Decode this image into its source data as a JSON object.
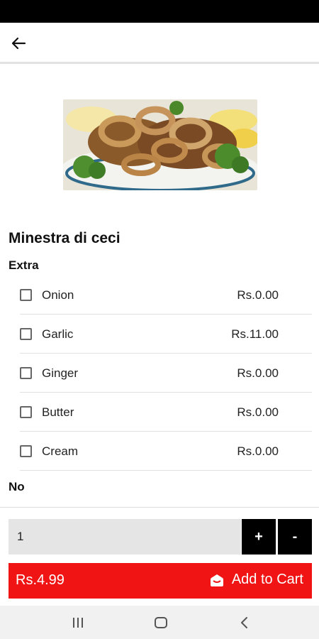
{
  "header": {
    "back_icon": "arrow-left-icon"
  },
  "product": {
    "image_alt": "fried calamari",
    "title": "Minestra di ceci"
  },
  "extras": {
    "heading": "Extra",
    "items": [
      {
        "label": "Onion",
        "price": "Rs.0.00"
      },
      {
        "label": "Garlic",
        "price": "Rs.11.00"
      },
      {
        "label": "Ginger",
        "price": "Rs.0.00"
      },
      {
        "label": "Butter",
        "price": "Rs.0.00"
      },
      {
        "label": "Cream",
        "price": "Rs.0.00"
      }
    ]
  },
  "no_section": {
    "heading": "No"
  },
  "quantity": {
    "value": "1",
    "plus_label": "+",
    "minus_label": "-"
  },
  "cart": {
    "price": "Rs.4.99",
    "button_label": "Add to Cart",
    "icon": "cart-icon"
  },
  "colors": {
    "accent": "#f01414",
    "qty_button": "#000000",
    "qty_field": "#e5e5e5"
  },
  "nav": {
    "icons": [
      "recents-icon",
      "home-icon",
      "back-icon"
    ]
  }
}
